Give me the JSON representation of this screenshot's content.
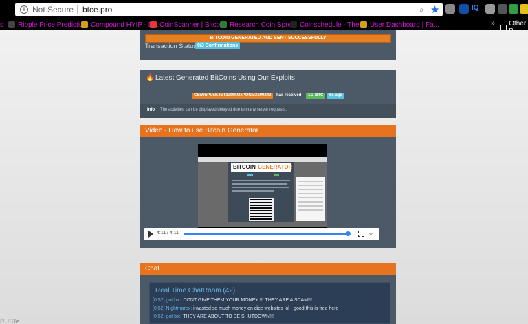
{
  "browser": {
    "security_label": "Not Secure",
    "url": "btce.pro",
    "info_glyph": "i",
    "zoom_glyph": "⌕",
    "star_glyph": "★",
    "extensions": [
      "#888",
      "#0f4fa5",
      "#999",
      "#555",
      "#2f9e44",
      "#e0c21a",
      "#c0392b"
    ],
    "extension_iq": "IQ",
    "bookmarks": [
      {
        "label": "s",
        "color": "#9c27b0"
      },
      {
        "label": "Ripple Price Predicti...",
        "color": "#444"
      },
      {
        "label": "Compound HYIP - D...",
        "color": "#d4a017"
      },
      {
        "label": "CoinScanner | Bitcoi...",
        "color": "#e53935"
      },
      {
        "label": "Research Coin Spre...",
        "color": "#2e7d32"
      },
      {
        "label": "Coinschedule - The...",
        "color": "#222"
      },
      {
        "label": "User Dashboard | Fa...",
        "color": "#d4a017"
      }
    ],
    "more": "»",
    "other_label": "Other B"
  },
  "panel1": {
    "generated_label": "BITCOIN GENERATED AND SENT SUCCESSFULLY",
    "tx_label": "Transaction Status:",
    "tx_badge": "0/3 Confirmations"
  },
  "panel2": {
    "title": "Latest Generated BitCoins Using Our Exploits",
    "address": "CEiWnPUsK4ET1atYhOxPONaIXz00242",
    "received_label": "has received",
    "amount": "1.2 BTC",
    "age": "6s ago",
    "info_label": "Info",
    "info_text": "The activities can be displayed delayed due to many server requests."
  },
  "panel3": {
    "title": "Video - How to use Bitcoin Generator",
    "logo_a": "BITCOIN",
    "logo_b": "GENERATOR",
    "time": "4:11 / 4:11",
    "progress": 1.0,
    "download_glyph": "⤓"
  },
  "panel4": {
    "title": "Chat",
    "room": "Real Time ChatRoom (42)",
    "messages": [
      {
        "time": "[0:52]",
        "user": "got btc:",
        "text": "DONT GIVE THEM YOUR MONEY !!! THEY ARE A SCAM!!!"
      },
      {
        "time": "[0:52]",
        "user": "Nightmarex:",
        "text": "i wasted so much money on dice websites lol - good this is free here"
      },
      {
        "time": "[0:52]",
        "user": "got btc:",
        "text": "THEY ARE ABOUT TO BE SHUTDOWN!!!"
      }
    ]
  },
  "corner_text": "RUSTe"
}
